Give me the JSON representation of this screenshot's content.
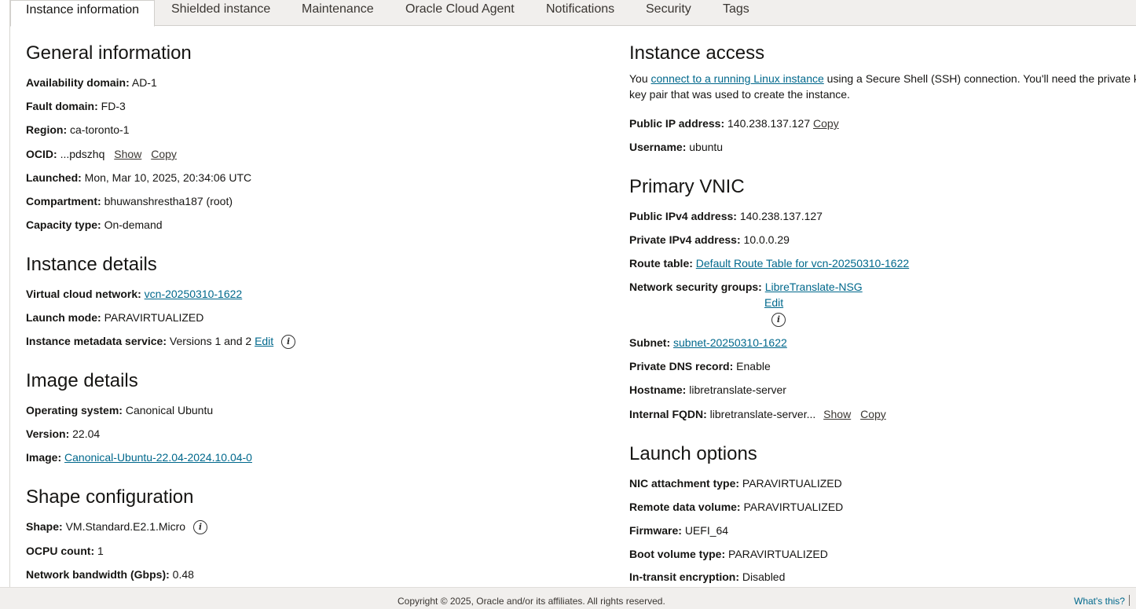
{
  "tabs": [
    "Instance information",
    "Shielded instance",
    "Maintenance",
    "Oracle Cloud Agent",
    "Notifications",
    "Security",
    "Tags"
  ],
  "general": {
    "heading": "General information",
    "availability_domain_label": "Availability domain:",
    "availability_domain": "AD-1",
    "fault_domain_label": "Fault domain:",
    "fault_domain": "FD-3",
    "region_label": "Region:",
    "region": "ca-toronto-1",
    "ocid_label": "OCID:",
    "ocid": "...pdszhq",
    "show": "Show",
    "copy": "Copy",
    "launched_label": "Launched:",
    "launched": "Mon, Mar 10, 2025, 20:34:06 UTC",
    "compartment_label": "Compartment:",
    "compartment": "bhuwanshrestha187 (root)",
    "capacity_label": "Capacity type:",
    "capacity": "On-demand"
  },
  "instance_details": {
    "heading": "Instance details",
    "vcn_label": "Virtual cloud network:",
    "vcn": "vcn-20250310-1622",
    "launch_mode_label": "Launch mode:",
    "launch_mode": "PARAVIRTUALIZED",
    "metadata_label": "Instance metadata service:",
    "metadata": "Versions 1 and 2",
    "edit": "Edit"
  },
  "image_details": {
    "heading": "Image details",
    "os_label": "Operating system:",
    "os": "Canonical Ubuntu",
    "version_label": "Version:",
    "version": "22.04",
    "image_label": "Image:",
    "image": "Canonical-Ubuntu-22.04-2024.10.04-0"
  },
  "shape": {
    "heading": "Shape configuration",
    "shape_label": "Shape:",
    "shape": "VM.Standard.E2.1.Micro",
    "ocpu_label": "OCPU count:",
    "ocpu": "1",
    "bandwidth_label": "Network bandwidth (Gbps):",
    "bandwidth": "0.48"
  },
  "access": {
    "heading": "Instance access",
    "text_before": "You ",
    "link": "connect to a running Linux instance",
    "text_after": " using a Secure Shell (SSH) connection. You'll need the private k",
    "text_line2": "key pair that was used to create the instance.",
    "public_ip_label": "Public IP address:",
    "public_ip": "140.238.137.127",
    "copy": "Copy",
    "username_label": "Username:",
    "username": "ubuntu"
  },
  "vnic": {
    "heading": "Primary VNIC",
    "public_ipv4_label": "Public IPv4 address:",
    "public_ipv4": "140.238.137.127",
    "private_ipv4_label": "Private IPv4 address:",
    "private_ipv4": "10.0.0.29",
    "route_label": "Route table:",
    "route": "Default Route Table for vcn-20250310-1622",
    "nsg_label": "Network security groups:",
    "nsg": "LibreTranslate-NSG",
    "edit": "Edit",
    "subnet_label": "Subnet:",
    "subnet": "subnet-20250310-1622",
    "dns_label": "Private DNS record:",
    "dns": "Enable",
    "hostname_label": "Hostname:",
    "hostname": "libretranslate-server",
    "fqdn_label": "Internal FQDN:",
    "fqdn": "libretranslate-server...",
    "show": "Show",
    "copy": "Copy"
  },
  "launch_options": {
    "heading": "Launch options",
    "nic_label": "NIC attachment type:",
    "nic": "PARAVIRTUALIZED",
    "remote_label": "Remote data volume:",
    "remote": "PARAVIRTUALIZED",
    "firmware_label": "Firmware:",
    "firmware": "UEFI_64",
    "boot_label": "Boot volume type:",
    "boot": "PARAVIRTUALIZED",
    "transit_label": "In-transit encryption:",
    "transit": "Disabled"
  },
  "footer": {
    "copyright": "Copyright © 2025, Oracle and/or its affiliates. All rights reserved.",
    "whats_this": "What's this?"
  },
  "icons": {
    "info": "i"
  }
}
